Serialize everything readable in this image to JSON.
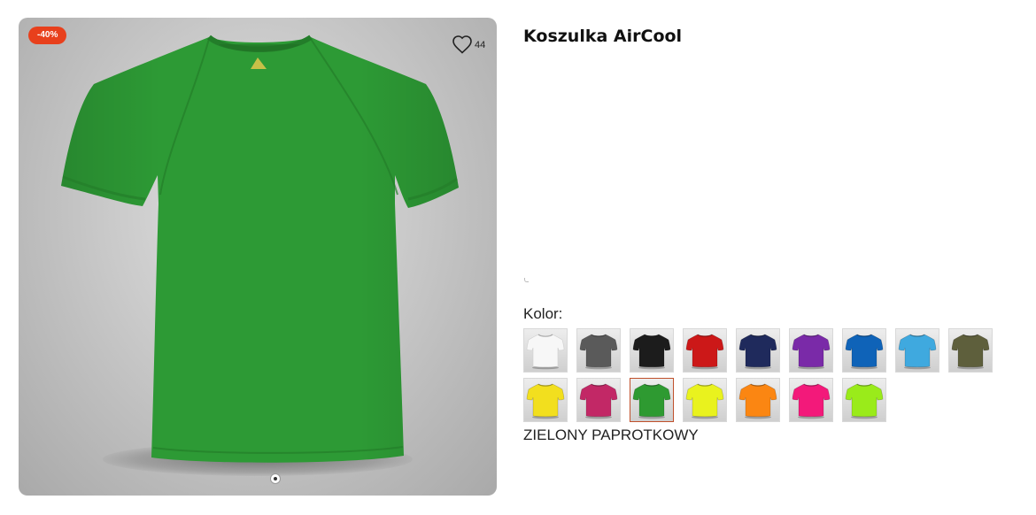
{
  "product": {
    "title": "Koszulka AirCool",
    "discount_badge": "-40%",
    "favorites_count": "44",
    "main_color": "#2d9a35"
  },
  "color_picker": {
    "label": "Kolor:",
    "selected_name": "ZIELONY PAPROTKOWY",
    "selected_index": 11,
    "swatches": [
      {
        "color": "#f7f7f7"
      },
      {
        "color": "#5a5a5a"
      },
      {
        "color": "#1c1c1c"
      },
      {
        "color": "#cc1818"
      },
      {
        "color": "#1f2a5c"
      },
      {
        "color": "#7a2aa8"
      },
      {
        "color": "#0f63b8"
      },
      {
        "color": "#3fa9df"
      },
      {
        "color": "#5e5f3c"
      },
      {
        "color": "#f2df1e"
      },
      {
        "color": "#c22866"
      },
      {
        "color": "#2e9a31"
      },
      {
        "color": "#e9f21e"
      },
      {
        "color": "#fb8612"
      },
      {
        "color": "#f3197a"
      },
      {
        "color": "#9aeb1a"
      }
    ]
  },
  "icons": {
    "favorite": "heart-outline-icon",
    "carousel": "carousel-dot-icon"
  }
}
